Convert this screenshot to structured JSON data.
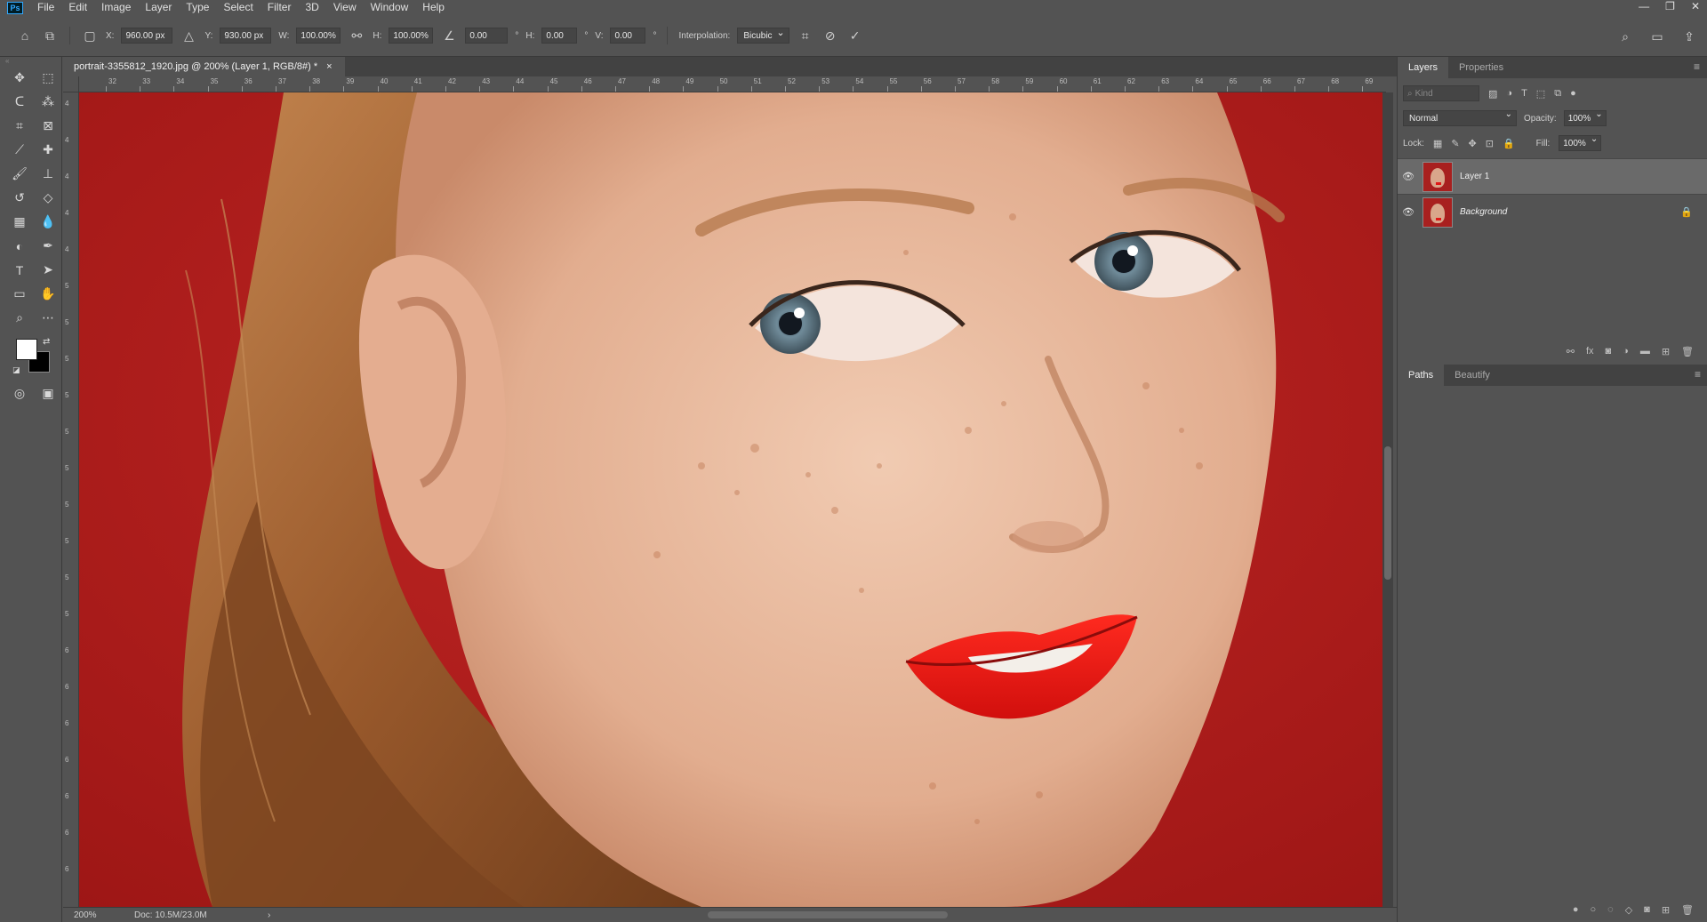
{
  "app": {
    "logo": "Ps"
  },
  "menu": [
    "File",
    "Edit",
    "Image",
    "Layer",
    "Type",
    "Select",
    "Filter",
    "3D",
    "View",
    "Window",
    "Help"
  ],
  "window_controls": [
    "—",
    "❐",
    "✕"
  ],
  "options": {
    "x_label": "X:",
    "x_value": "960.00 px",
    "y_label": "Y:",
    "y_value": "930.00 px",
    "w_label": "W:",
    "w_value": "100.00%",
    "h_label": "H:",
    "h_value": "100.00%",
    "angle_value": "0.00",
    "hskew_label": "H:",
    "hskew_value": "0.00",
    "vskew_label": "V:",
    "vskew_value": "0.00",
    "interpolation_label": "Interpolation:",
    "interpolation_value": "Bicubic",
    "degree": "°"
  },
  "document": {
    "tab_title": "portrait-3355812_1920.jpg @ 200% (Layer 1, RGB/8#) *",
    "close": "×"
  },
  "ruler": {
    "top": [
      "32",
      "33",
      "34",
      "35",
      "36",
      "37",
      "38",
      "39",
      "40",
      "41",
      "42",
      "43",
      "44",
      "45",
      "46",
      "47",
      "48",
      "49",
      "50",
      "51",
      "52",
      "53",
      "54",
      "55",
      "56",
      "57",
      "58",
      "59",
      "60",
      "61",
      "62",
      "63",
      "64",
      "65",
      "66",
      "67",
      "68",
      "69"
    ],
    "left": [
      "4",
      "4",
      "4",
      "4",
      "4",
      "5",
      "5",
      "5",
      "5",
      "5",
      "5",
      "5",
      "5",
      "5",
      "5",
      "6",
      "6",
      "6",
      "6",
      "6",
      "6",
      "6"
    ]
  },
  "status": {
    "zoom": "200%",
    "doc": "Doc: 10.5M/23.0M",
    "arrow": "›"
  },
  "layers_panel": {
    "tabs": [
      "Layers",
      "Properties"
    ],
    "search_placeholder": "Kind",
    "blend_mode": "Normal",
    "opacity_label": "Opacity:",
    "opacity_value": "100%",
    "lock_label": "Lock:",
    "fill_label": "Fill:",
    "fill_value": "100%",
    "layers": [
      {
        "name": "Layer 1",
        "visible": true,
        "selected": true,
        "locked": false
      },
      {
        "name": "Background",
        "visible": true,
        "selected": false,
        "locked": true
      }
    ]
  },
  "paths_panel": {
    "tabs": [
      "Paths",
      "Beautify"
    ]
  },
  "colors": {
    "foreground": "#ffffff",
    "background": "#000000",
    "canvas_bg": "#b51d1c"
  }
}
